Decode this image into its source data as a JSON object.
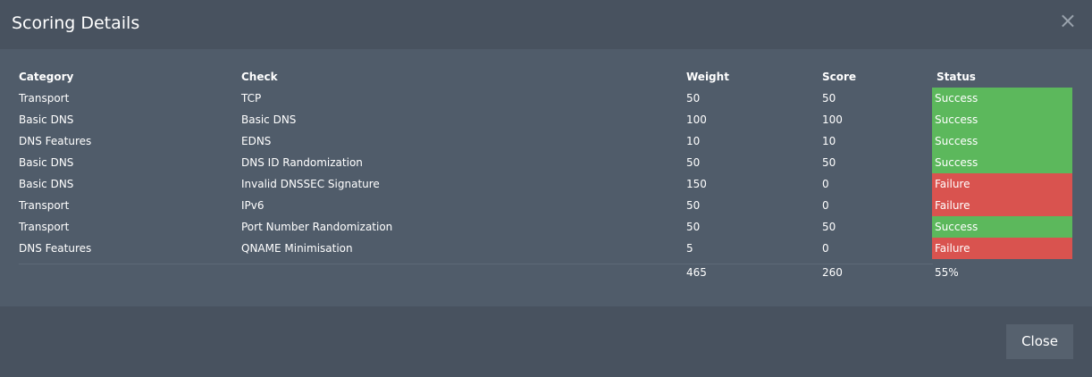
{
  "dialog": {
    "title": "Scoring Details",
    "close_icon": "×",
    "close_label": "Close"
  },
  "table": {
    "headers": {
      "category": "Category",
      "check": "Check",
      "weight": "Weight",
      "score": "Score",
      "status": "Status"
    },
    "rows": [
      {
        "category": "Transport",
        "check": "TCP",
        "weight": "50",
        "score": "50",
        "status": "Success"
      },
      {
        "category": "Basic DNS",
        "check": "Basic DNS",
        "weight": "100",
        "score": "100",
        "status": "Success"
      },
      {
        "category": "DNS Features",
        "check": "EDNS",
        "weight": "10",
        "score": "10",
        "status": "Success"
      },
      {
        "category": "Basic DNS",
        "check": "DNS ID Randomization",
        "weight": "50",
        "score": "50",
        "status": "Success"
      },
      {
        "category": "Basic DNS",
        "check": "Invalid DNSSEC Signature",
        "weight": "150",
        "score": "0",
        "status": "Failure"
      },
      {
        "category": "Transport",
        "check": "IPv6",
        "weight": "50",
        "score": "0",
        "status": "Failure"
      },
      {
        "category": "Transport",
        "check": "Port Number Randomization",
        "weight": "50",
        "score": "50",
        "status": "Success"
      },
      {
        "category": "DNS Features",
        "check": "QNAME Minimisation",
        "weight": "5",
        "score": "0",
        "status": "Failure"
      }
    ],
    "totals": {
      "weight": "465",
      "score": "260",
      "status": "55%"
    }
  },
  "colors": {
    "success": "#5cb85c",
    "failure": "#d9534f"
  }
}
